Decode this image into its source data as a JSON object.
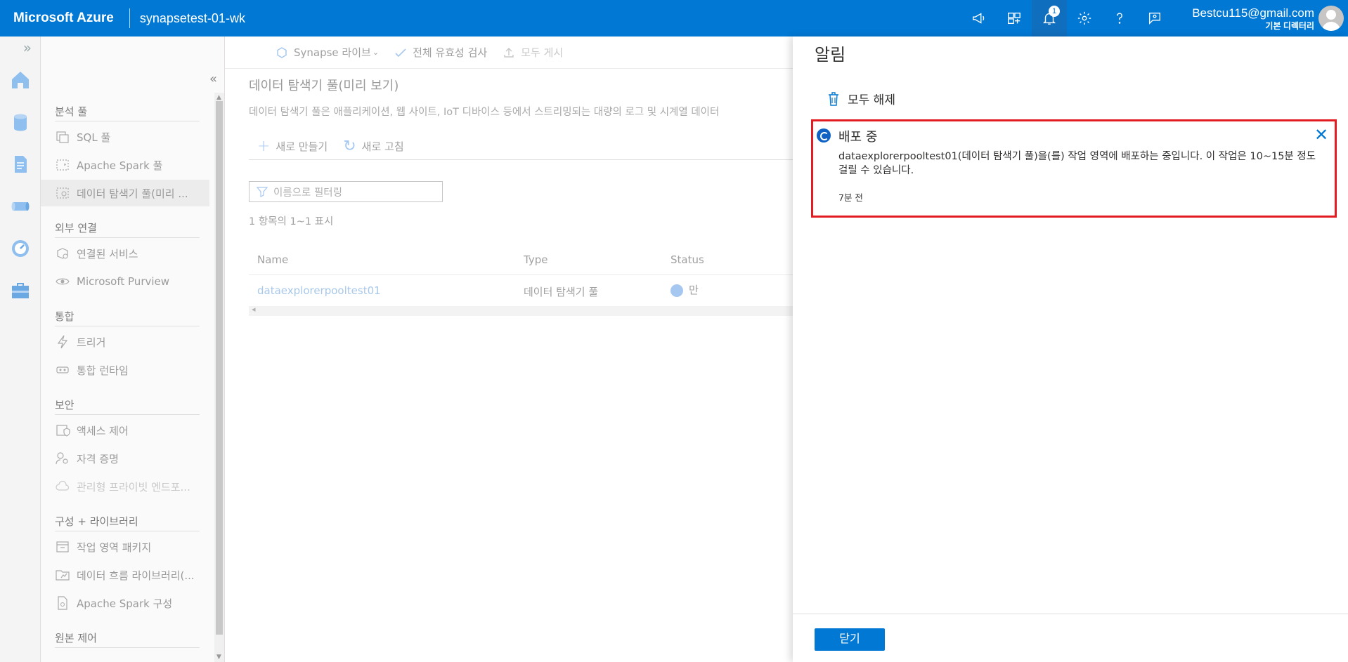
{
  "header": {
    "brand": "Microsoft Azure",
    "workspace": "synapsetest-01-wk",
    "notification_count": "1",
    "user_email": "Bestcu115@gmail.com",
    "user_directory": "기본 디렉터리",
    "icons": [
      "megaphone-icon",
      "switch-directory-icon",
      "bell-icon",
      "gear-icon",
      "help-icon",
      "feedback-icon"
    ]
  },
  "toolbar": {
    "synapse_live": "Synapse 라이브",
    "validate_all": "전체 유효성 검사",
    "publish_all": "모두 게시"
  },
  "sidebar": {
    "sections": [
      {
        "title": "분석 풀",
        "items": [
          "SQL 풀",
          "Apache Spark 풀",
          "데이터 탐색기 풀(미리 ..."
        ]
      },
      {
        "title": "외부 연결",
        "items": [
          "연결된 서비스",
          "Microsoft Purview"
        ]
      },
      {
        "title": "통합",
        "items": [
          "트리거",
          "통합 런타임"
        ]
      },
      {
        "title": "보안",
        "items": [
          "액세스 제어",
          "자격 증명",
          "관리형 프라이빗 엔드포..."
        ]
      },
      {
        "title": "구성 + 라이브러리",
        "items": [
          "작업 영역 패키지",
          "데이터 흐름 라이브러리(...",
          "Apache Spark 구성"
        ]
      },
      {
        "title": "원본 제어",
        "items": []
      }
    ]
  },
  "main": {
    "title": "데이터 탐색기 풀(미리 보기)",
    "description": "데이터 탐색기 풀은 애플리케이션, 웹 사이트, IoT 디바이스 등에서 스트리밍되는 대량의 로그 및 시계열 데이터",
    "new_label": "새로 만들기",
    "refresh_label": "새로 고침",
    "filter_placeholder": "이름으로 필터링",
    "count_text": "1 항목의 1~1 표시",
    "columns": [
      "Name",
      "Type",
      "Status"
    ],
    "rows": [
      {
        "name": "dataexplorerpooltest01",
        "type": "데이터 탐색기 풀",
        "status": "만"
      }
    ]
  },
  "notifications": {
    "panel_title": "알림",
    "dismiss_all": "모두 해제",
    "items": [
      {
        "title": "배포 중",
        "message": "dataexplorerpooltest01(데이터 탐색기 풀)을(를) 작업 영역에 배포하는 중입니다. 이 작업은 10~15분 정도 걸릴 수 있습니다.",
        "time": "7분 전"
      }
    ],
    "close_label": "닫기"
  },
  "colors": {
    "accent": "#0078d4",
    "highlight_border": "#e31b23"
  }
}
